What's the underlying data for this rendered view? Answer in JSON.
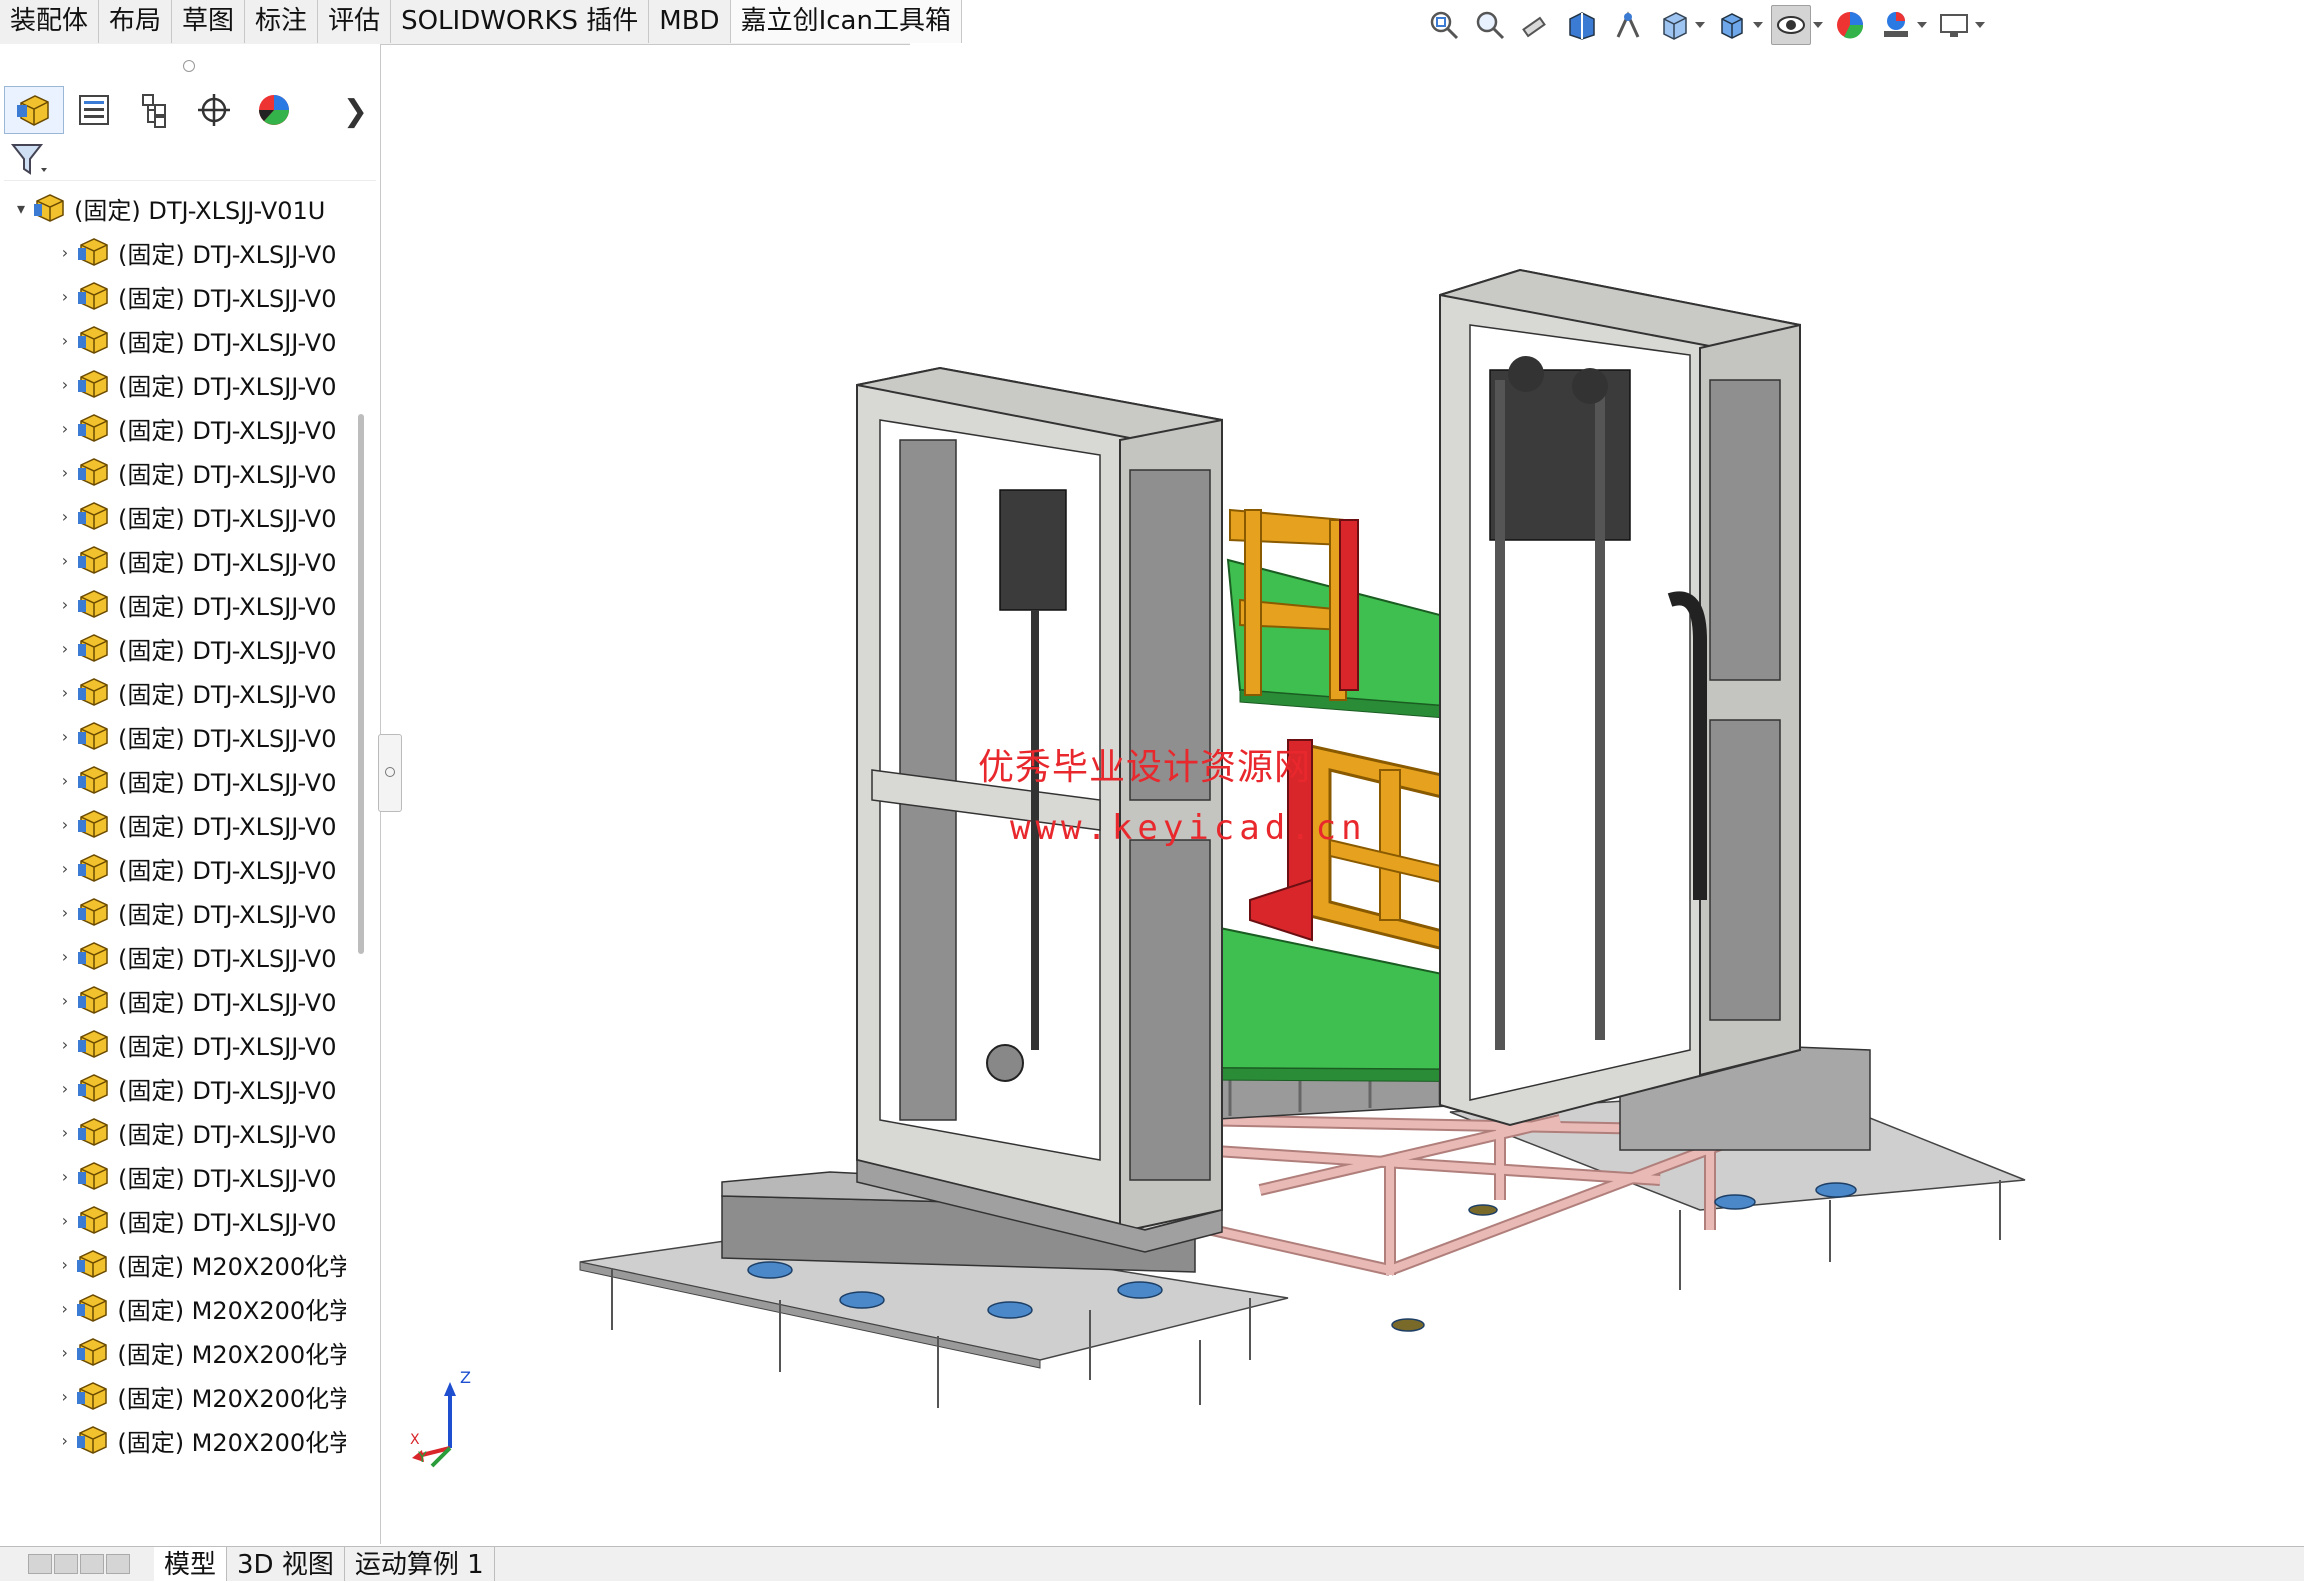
{
  "command_tabs": [
    "装配体",
    "布局",
    "草图",
    "标注",
    "评估",
    "SOLIDWORKS 插件",
    "MBD",
    "嘉立创Ican工具箱"
  ],
  "view_toolbar": [
    "zoom-to-fit-icon",
    "zoom-to-area-icon",
    "previous-view-icon",
    "section-view-icon",
    "dynamic-annotation-icon",
    "view-orientation-icon",
    "display-style-icon",
    "hide-show-items-icon",
    "edit-appearance-icon",
    "apply-scene-icon",
    "view-settings-icon"
  ],
  "feature_manager": {
    "tabs": [
      "feature-manager-tab",
      "property-manager-tab",
      "configuration-manager-tab",
      "dimxpert-manager-tab",
      "display-manager-tab"
    ],
    "root": "(固定) DTJ-XLSJJ-V01U",
    "children": [
      "(固定) DTJ-XLSJJ-V0",
      "(固定) DTJ-XLSJJ-V0",
      "(固定) DTJ-XLSJJ-V0",
      "(固定) DTJ-XLSJJ-V0",
      "(固定) DTJ-XLSJJ-V0",
      "(固定) DTJ-XLSJJ-V0",
      "(固定) DTJ-XLSJJ-V0",
      "(固定) DTJ-XLSJJ-V0",
      "(固定) DTJ-XLSJJ-V0",
      "(固定) DTJ-XLSJJ-V0",
      "(固定) DTJ-XLSJJ-V0",
      "(固定) DTJ-XLSJJ-V0",
      "(固定) DTJ-XLSJJ-V0",
      "(固定) DTJ-XLSJJ-V0",
      "(固定) DTJ-XLSJJ-V0",
      "(固定) DTJ-XLSJJ-V0",
      "(固定) DTJ-XLSJJ-V0",
      "(固定) DTJ-XLSJJ-V0",
      "(固定) DTJ-XLSJJ-V0",
      "(固定) DTJ-XLSJJ-V0",
      "(固定) DTJ-XLSJJ-V0",
      "(固定) DTJ-XLSJJ-V0",
      "(固定) DTJ-XLSJJ-V0",
      "(固定) M20X200化学",
      "(固定) M20X200化学",
      "(固定) M20X200化学",
      "(固定) M20X200化学",
      "(固定) M20X200化学"
    ]
  },
  "bottom_tabs": [
    "模型",
    "3D 视图",
    "运动算例 1"
  ],
  "watermark": {
    "line1": "优秀毕业设计资源网",
    "line2": "www.keyicad.cn"
  },
  "triad": {
    "z": "Z",
    "x": "X",
    "y": "Y"
  },
  "colors": {
    "frame_gray": "#d8d8d4",
    "pallet_green": "#3fbf4f",
    "fork_orange": "#e6a21e",
    "support_pink": "#e9b9b6",
    "accent_red": "#d8262a",
    "base_plate": "#cfcfcf"
  }
}
